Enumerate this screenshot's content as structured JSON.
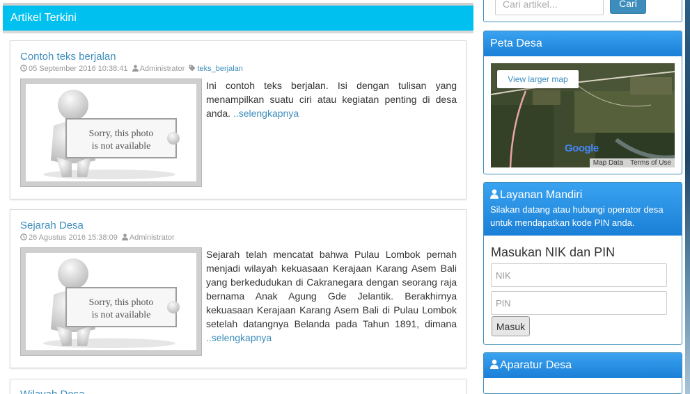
{
  "main": {
    "header_title": "Artikel Terkini",
    "articles": [
      {
        "title": "Contoh teks berjalan",
        "date": "05 September 2016 10:38:41",
        "author": "Administrator",
        "tag": "teks_berjalan",
        "image_caption_1": "Sorry, this photo",
        "image_caption_2": "is not available",
        "excerpt": "Ini contoh teks berjalan. Isi dengan tulisan yang menampilkan suatu ciri atau kegiatan penting di desa anda.",
        "read_more": "..selengkapnya"
      },
      {
        "title": "Sejarah Desa",
        "date": "26 Agustus 2016 15:38:09",
        "author": "Administrator",
        "image_caption_1": "Sorry, this photo",
        "image_caption_2": "is not available",
        "excerpt": "Sejarah telah mencatat bahwa Pulau Lombok pernah menjadi wilayah kekuasaan Kerajaan Karang Asem Bali yang berkedudukan di Cakranegara dengan seorang raja bernama Anak Agung Gde Jelantik. Berakhirnya kekuasaan Kerajaan Karang Asem Bali di Pulau Lombok setelah datangnya Belanda pada Tahun 1891, dimana",
        "read_more": "..selengkapnya"
      },
      {
        "title": "Wilayah Desa"
      }
    ]
  },
  "sidebar": {
    "search": {
      "placeholder": "Cari artikel...",
      "button_label": "Cari"
    },
    "peta_desa": {
      "title": "Peta Desa",
      "view_larger_map": "View larger map",
      "google_logo": "Google",
      "map_data": "Map Data",
      "terms": "Terms of Use"
    },
    "layanan_mandiri": {
      "title": "Layanan Mandiri",
      "description": "Silakan datang atau hubungi operator desa untuk mendapatkan kode PIN anda.",
      "form_title": "Masukan NIK dan PIN",
      "nik_placeholder": "NIK",
      "pin_placeholder": "PIN",
      "submit_label": "Masuk"
    },
    "aparatur_desa": {
      "title": "Aparatur Desa"
    }
  },
  "colors": {
    "header_cyan": "#00c0ef",
    "link_blue": "#3c8dbc",
    "box_head_blue": "#1a7fd6"
  }
}
